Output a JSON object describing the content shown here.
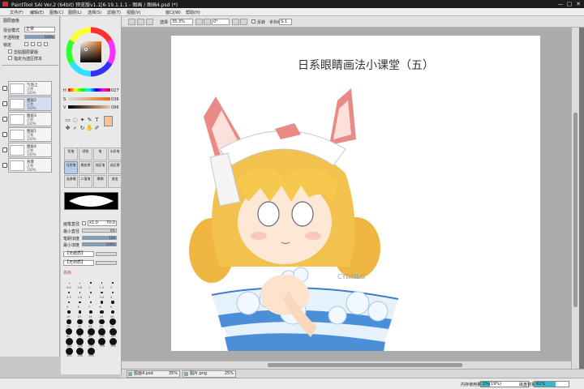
{
  "window": {
    "title": "PaintTool SAI Ver.2 (64bit) 预览版v1.1[6-19.1.1.1 - 图画 / 图画4.psd (*)",
    "controls": [
      "—",
      "□",
      "✕"
    ]
  },
  "menu": {
    "items": [
      "文件(F)",
      "编辑(E)",
      "图像(C)",
      "图层(L)",
      "选择(S)",
      "滤镜(T)",
      "视图(V)",
      "窗口(W)",
      "帮助(H)"
    ]
  },
  "toolbar": {
    "zoom_label": "选择",
    "zoom_value": "35.3%",
    "angle_value": "0°",
    "flip_label": "反转",
    "blend_label": "手抖修正",
    "blend_value": "S-1"
  },
  "left_panel": {
    "header": "图层面板",
    "mode_label": "混合模式",
    "mode_value": "正常",
    "opacity_label": "不透明度",
    "opacity_value": "100%",
    "opacity_fraction": 1.0,
    "lock_label": "锁定",
    "clip_label": "剪贴图层蒙版",
    "selection_label": "指定为选区样本",
    "layers": [
      {
        "name": "气泡上",
        "mode": "正常",
        "opacity": "100%",
        "selected": false
      },
      {
        "name": "图层2",
        "mode": "正常",
        "opacity": "100%",
        "selected": true
      },
      {
        "name": "图层3",
        "mode": "正常",
        "opacity": "100%",
        "selected": false
      },
      {
        "name": "图层1",
        "mode": "正常",
        "opacity": "100%",
        "selected": false
      },
      {
        "name": "图层4",
        "mode": "正常",
        "opacity": "100%",
        "selected": false
      },
      {
        "name": "背景",
        "mode": "正常",
        "opacity": "100%",
        "selected": false
      }
    ]
  },
  "color_panel": {
    "h_label": "H",
    "h_value": "027",
    "s_label": "S",
    "s_value": "036",
    "v_label": "V",
    "v_value": "096",
    "current_color": "#f2c39a"
  },
  "tools": {
    "brushes": [
      {
        "name": "铅笔",
        "active": false
      },
      {
        "name": "喷枪",
        "active": false
      },
      {
        "name": "笔",
        "active": false
      },
      {
        "name": "水彩笔",
        "active": false
      },
      {
        "name": "马克笔",
        "active": true
      },
      {
        "name": "橡皮擦",
        "active": false
      },
      {
        "name": "选区笔",
        "active": false
      },
      {
        "name": "选区擦",
        "active": false
      },
      {
        "name": "油漆桶",
        "active": false
      },
      {
        "name": "二值笔",
        "active": false
      },
      {
        "name": "模糊",
        "active": false
      },
      {
        "name": "渐变",
        "active": false
      }
    ],
    "properties": {
      "normal_label": "普通",
      "size_label": "画笔直径",
      "size_mult": "x1.0",
      "size_value": "70.0",
      "min_size_label": "最小直径",
      "min_size_value": "0%",
      "density_label": "笔刷浓度",
      "density_value": "100",
      "min_density_label": "最小浓度",
      "min_density_value": "100%",
      "shape_label": "【无纸质】",
      "texture_label": "【无材质】",
      "blend_label": "高级"
    },
    "size_presets": [
      "0.6",
      "0.8",
      "1",
      "1.5",
      "2",
      "2.3",
      "2.6",
      "3",
      "3.5",
      "4",
      "5",
      "6",
      "7",
      "8",
      "9",
      "10",
      "12",
      "14",
      "16",
      "20",
      "25",
      "30",
      "35",
      "40",
      "50",
      "60",
      "70",
      "80",
      "100",
      "120",
      "160",
      "200",
      "250",
      "300",
      "350",
      "400",
      "450",
      "500"
    ]
  },
  "canvas": {
    "artwork_title": "日系眼睛画法小课堂（五）",
    "signature": "CYDMLG"
  },
  "file_tabs": [
    {
      "name": "图画4.psd",
      "zoom": "35%"
    },
    {
      "name": "图片.png",
      "zoom": "25%"
    }
  ],
  "status": {
    "memory_label": "内存使用量",
    "memory_value": "1%(19%)",
    "memory_fraction": 0.19,
    "disk_label": "磁盘容量",
    "disk_value": "61%",
    "disk_fraction": 0.61
  },
  "colors": {
    "accent": "#39b8c8",
    "paper": "#ffffff",
    "canvas_bg": "#ababab"
  }
}
